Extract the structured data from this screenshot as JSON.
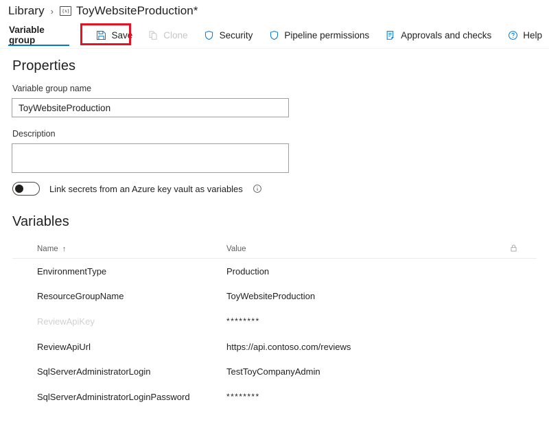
{
  "breadcrumb": {
    "root_label": "Library",
    "separator": "›",
    "group_icon": "variable-group-icon",
    "group_icon_glyph": "{x}",
    "current_label": "ToyWebsiteProduction*"
  },
  "toolbar": {
    "tab_label": "Variable group",
    "save_label": "Save",
    "clone_label": "Clone",
    "security_label": "Security",
    "pipeline_permissions_label": "Pipeline permissions",
    "approvals_label": "Approvals and checks",
    "help_label": "Help",
    "highlight_color": "#e81123",
    "accent_color": "#0078d4",
    "disabled_color": "#c8c6c4"
  },
  "properties": {
    "heading": "Properties",
    "name_label": "Variable group name",
    "name_value": "ToyWebsiteProduction",
    "name_placeholder": "",
    "description_label": "Description",
    "description_value": "",
    "description_placeholder": "",
    "keyvault_toggle_label": "Link secrets from an Azure key vault as variables",
    "keyvault_toggle_state": "off",
    "info_icon": "info-icon"
  },
  "variables": {
    "heading": "Variables",
    "columns": {
      "name": "Name",
      "sort_indicator": "↑",
      "value": "Value",
      "lock": "lock-icon"
    },
    "rows": [
      {
        "name": "EnvironmentType",
        "value": "Production",
        "dim": false,
        "masked": false
      },
      {
        "name": "ResourceGroupName",
        "value": "ToyWebsiteProduction",
        "dim": false,
        "masked": false
      },
      {
        "name": "ReviewApiKey",
        "value": "********",
        "dim": true,
        "masked": true
      },
      {
        "name": "ReviewApiUrl",
        "value": "https://api.contoso.com/reviews",
        "dim": false,
        "masked": false
      },
      {
        "name": "SqlServerAdministratorLogin",
        "value": "TestToyCompanyAdmin",
        "dim": false,
        "masked": false
      },
      {
        "name": "SqlServerAdministratorLoginPassword",
        "value": "********",
        "dim": false,
        "masked": true
      }
    ]
  }
}
